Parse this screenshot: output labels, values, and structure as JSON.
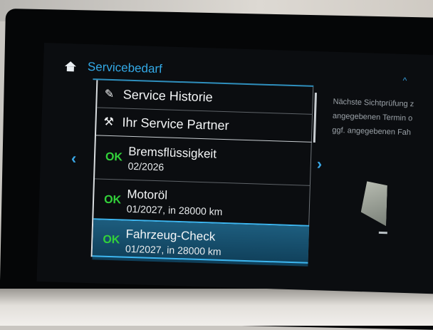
{
  "header": {
    "title": "Servicebedarf"
  },
  "menu_items": [
    {
      "label": "Service Historie",
      "icon": "service-book-icon"
    },
    {
      "label": "Ihr Service Partner",
      "icon": "wrench-icon"
    }
  ],
  "service_items": [
    {
      "status": "OK",
      "name": "Bremsflüssigkeit",
      "due": "02/2026",
      "selected": false
    },
    {
      "status": "OK",
      "name": "Motoröl",
      "due": "01/2027, in 28000 km",
      "selected": false
    },
    {
      "status": "OK",
      "name": "Fahrzeug-Check",
      "due": "01/2027, in 28000 km",
      "selected": true
    }
  ],
  "info_panel": {
    "lines": [
      "Nächste Sichtprüfung z",
      "angegebenen Termin o",
      "ggf. angegebenen Fah"
    ]
  },
  "colors": {
    "accent": "#33a9e6",
    "ok": "#32d13a",
    "selected": "#1d5d7e"
  },
  "icons": {
    "home": "home-icon",
    "left": "chevron-left-icon",
    "right": "chevron-right-icon",
    "up": "chevron-up-icon"
  }
}
